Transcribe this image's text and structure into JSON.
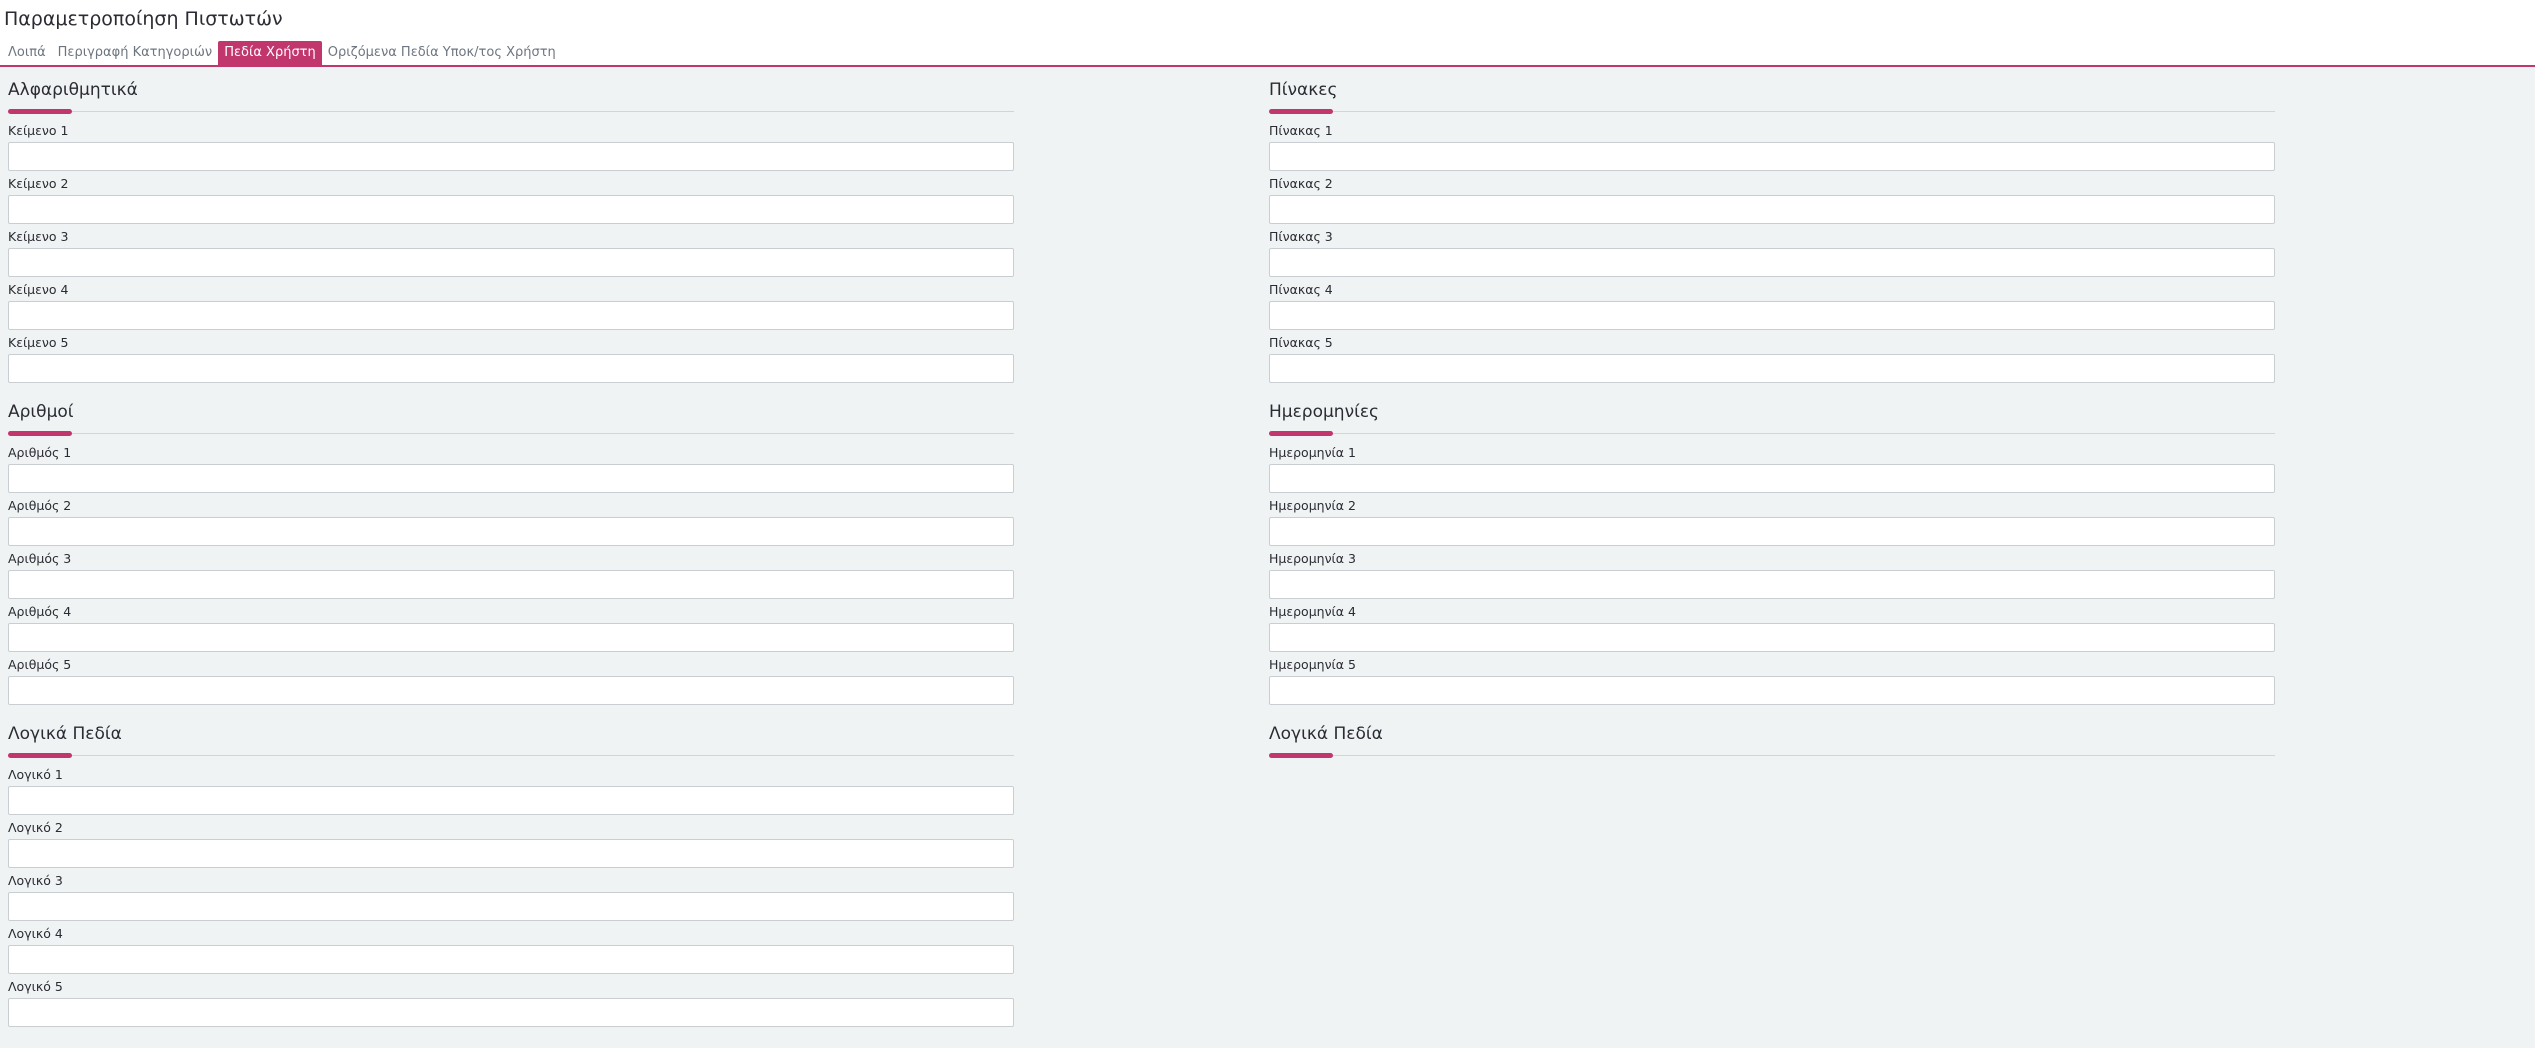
{
  "page": {
    "title": "Παραμετροποίηση Πιστωτών"
  },
  "tabs": [
    {
      "label": "Λοιπά",
      "active": false
    },
    {
      "label": "Περιγραφή Κατηγοριών",
      "active": false
    },
    {
      "label": "Πεδία Χρήστη",
      "active": true
    },
    {
      "label": "Οριζόμενα Πεδία Υποκ/τος Χρήστη",
      "active": false
    }
  ],
  "colors": {
    "accent": "#c2366e",
    "background": "#f0f3f3",
    "header": "#ffffff"
  },
  "sections": {
    "text": {
      "title": "Αλφαριθμητικά",
      "fields": [
        {
          "label": "Κείμενο 1",
          "value": ""
        },
        {
          "label": "Κείμενο 2",
          "value": ""
        },
        {
          "label": "Κείμενο 3",
          "value": ""
        },
        {
          "label": "Κείμενο 4",
          "value": ""
        },
        {
          "label": "Κείμενο 5",
          "value": ""
        }
      ]
    },
    "tables": {
      "title": "Πίνακες",
      "fields": [
        {
          "label": "Πίνακας 1",
          "value": ""
        },
        {
          "label": "Πίνακας 2",
          "value": ""
        },
        {
          "label": "Πίνακας 3",
          "value": ""
        },
        {
          "label": "Πίνακας 4",
          "value": ""
        },
        {
          "label": "Πίνακας 5",
          "value": ""
        }
      ]
    },
    "numbers": {
      "title": "Αριθμοί",
      "fields": [
        {
          "label": "Αριθμός 1",
          "value": ""
        },
        {
          "label": "Αριθμός 2",
          "value": ""
        },
        {
          "label": "Αριθμός 3",
          "value": ""
        },
        {
          "label": "Αριθμός 4",
          "value": ""
        },
        {
          "label": "Αριθμός 5",
          "value": ""
        }
      ]
    },
    "dates": {
      "title": "Ημερομηνίες",
      "fields": [
        {
          "label": "Ημερομηνία 1",
          "value": ""
        },
        {
          "label": "Ημερομηνία 2",
          "value": ""
        },
        {
          "label": "Ημερομηνία 3",
          "value": ""
        },
        {
          "label": "Ημερομηνία 4",
          "value": ""
        },
        {
          "label": "Ημερομηνία 5",
          "value": ""
        }
      ]
    },
    "logical": {
      "title": "Λογικά Πεδία",
      "fields": [
        {
          "label": "Λογικό 1",
          "value": ""
        },
        {
          "label": "Λογικό 2",
          "value": ""
        },
        {
          "label": "Λογικό 3",
          "value": ""
        },
        {
          "label": "Λογικό 4",
          "value": ""
        },
        {
          "label": "Λογικό 5",
          "value": ""
        }
      ]
    },
    "logical_right": {
      "title": "Λογικά Πεδία",
      "fields": []
    }
  }
}
